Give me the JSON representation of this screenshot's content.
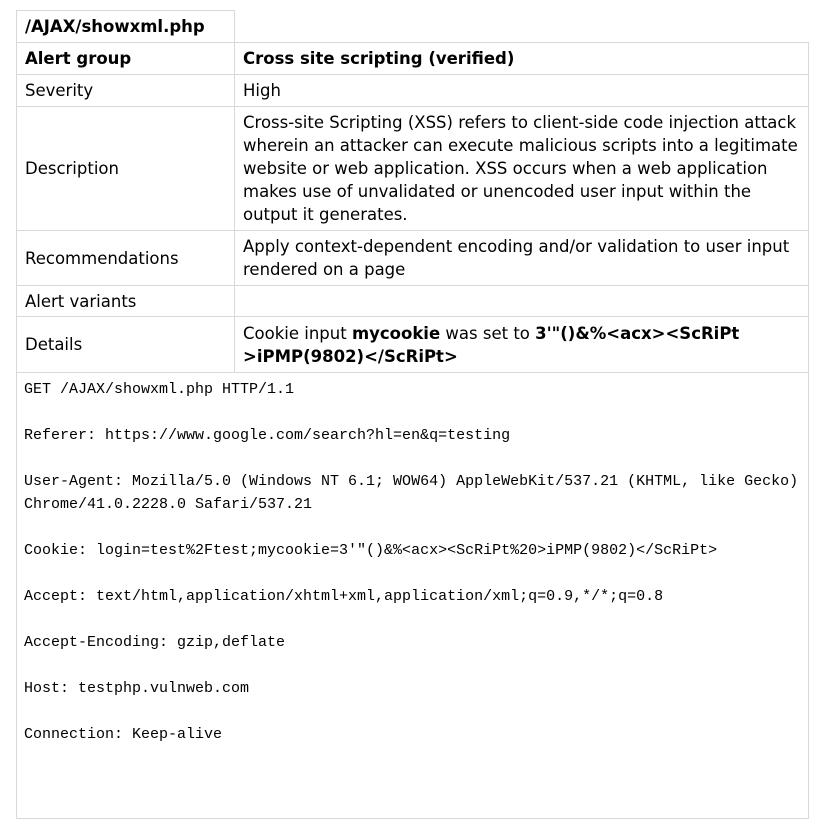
{
  "page": {
    "path": "/AJAX/showxml.php"
  },
  "alert": {
    "group_label": "Alert group",
    "group_value": "Cross site scripting (verified)",
    "severity_label": "Severity",
    "severity_value": "High",
    "description_label": "Description",
    "description_lines": [
      "Cross-site Scripting (XSS) refers to client-side code injection attack",
      "wherein an attacker can execute malicious scripts into a legitimate",
      "website or web application. XSS occurs when a web application",
      "makes use of unvalidated or unencoded user input within the",
      "output it generates."
    ],
    "recommendations_label": "Recommendations",
    "recommendations_lines": [
      "Apply context-dependent encoding and/or validation to user input",
      "rendered on a page"
    ],
    "variants_label": "Alert variants",
    "details_label": "Details",
    "details": {
      "prefix": "Cookie input ",
      "input_name": "mycookie",
      "middle": " was set to ",
      "payload": "3'\"()&%<acx><ScRiPt >iPMP(9802)</ScRiPt>"
    }
  },
  "request": {
    "lines": [
      "GET /AJAX/showxml.php HTTP/1.1",
      "Referer: https://www.google.com/search?hl=en&q=testing",
      "User-Agent: Mozilla/5.0 (Windows NT 6.1; WOW64) AppleWebKit/537.21 (KHTML, like Gecko) Chrome/41.0.2228.0 Safari/537.21",
      "Cookie: login=test%2Ftest;mycookie=3'\"()&%<acx><ScRiPt%20>iPMP(9802)</ScRiPt>",
      "Accept: text/html,application/xhtml+xml,application/xml;q=0.9,*/*;q=0.8",
      "Accept-Encoding: gzip,deflate",
      "Host: testphp.vulnweb.com",
      "Connection: Keep-alive"
    ]
  },
  "colors": {
    "border": "#d9d9d9",
    "text": "#000000",
    "background": "#ffffff"
  }
}
